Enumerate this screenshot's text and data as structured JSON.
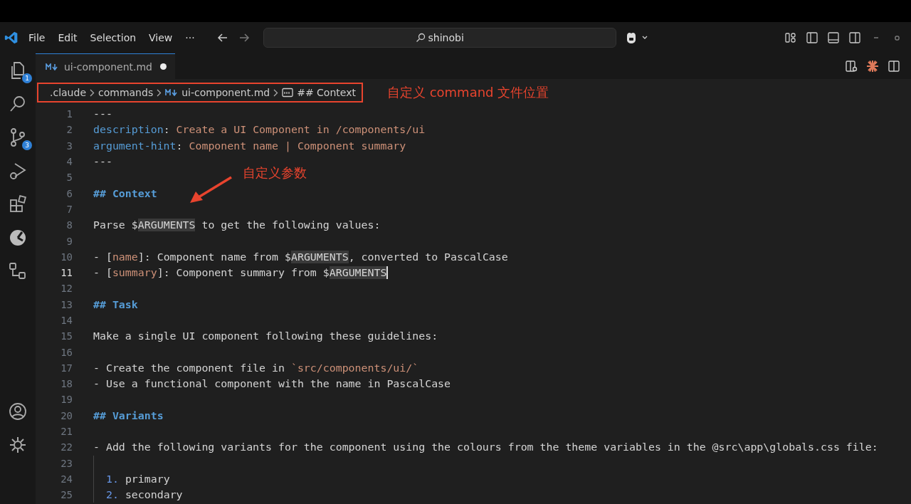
{
  "menu": [
    "File",
    "Edit",
    "Selection",
    "View",
    "···"
  ],
  "search": {
    "value": "shinobi"
  },
  "activity": [
    {
      "kind": "files",
      "badge": "1"
    },
    {
      "kind": "search"
    },
    {
      "kind": "scm",
      "badge": "3"
    },
    {
      "kind": "debug"
    },
    {
      "kind": "extensions"
    },
    {
      "kind": "remote"
    },
    {
      "kind": "flow"
    },
    {
      "kind": "account"
    },
    {
      "kind": "gear"
    }
  ],
  "tab": {
    "label": "ui-component.md",
    "modified": true
  },
  "breadcrumb": [
    {
      "kind": "folder",
      "label": ".claude"
    },
    {
      "kind": "folder",
      "label": "commands"
    },
    {
      "kind": "file",
      "label": "ui-component.md"
    },
    {
      "kind": "symbol",
      "label": "## Context"
    }
  ],
  "annotations": [
    {
      "kind": "box-label",
      "text": "自定义 command 文件位置"
    },
    {
      "kind": "arrow-label",
      "text": "自定义参数"
    }
  ],
  "lines": [
    {
      "n": "1",
      "tokens": [
        {
          "kind": "text",
          "t": "---"
        }
      ]
    },
    {
      "n": "2",
      "tokens": [
        {
          "kind": "key",
          "t": "description"
        },
        {
          "kind": "text",
          "t": ": "
        },
        {
          "kind": "value",
          "t": "Create a UI Component in /components/ui"
        }
      ]
    },
    {
      "n": "3",
      "tokens": [
        {
          "kind": "key",
          "t": "argument-hint"
        },
        {
          "kind": "text",
          "t": ": "
        },
        {
          "kind": "value",
          "t": "Component name | Component summary"
        }
      ]
    },
    {
      "n": "4",
      "tokens": [
        {
          "kind": "text",
          "t": "---"
        }
      ]
    },
    {
      "n": "5"
    },
    {
      "n": "6",
      "tokens": [
        {
          "kind": "heading",
          "t": "## Context"
        }
      ]
    },
    {
      "n": "7"
    },
    {
      "n": "8",
      "tokens": [
        {
          "kind": "text",
          "t": "Parse $"
        },
        {
          "kind": "var",
          "t": "ARGUMENTS"
        },
        {
          "kind": "text",
          "t": " to get the following values:"
        }
      ]
    },
    {
      "n": "9"
    },
    {
      "n": "10",
      "tokens": [
        {
          "kind": "text",
          "t": "- ["
        },
        {
          "kind": "link",
          "t": "name"
        },
        {
          "kind": "text",
          "t": "]: Component name from $"
        },
        {
          "kind": "var",
          "t": "ARGUMENTS"
        },
        {
          "kind": "text",
          "t": ", converted to PascalCase"
        }
      ]
    },
    {
      "n": "11",
      "current": true,
      "tokens": [
        {
          "kind": "text",
          "t": "- ["
        },
        {
          "kind": "link",
          "t": "summary"
        },
        {
          "kind": "text",
          "t": "]: Component summary from $"
        },
        {
          "kind": "var",
          "t": "ARGUMENTS"
        }
      ]
    },
    {
      "n": "12"
    },
    {
      "n": "13",
      "tokens": [
        {
          "kind": "heading",
          "t": "## Task"
        }
      ]
    },
    {
      "n": "14"
    },
    {
      "n": "15",
      "tokens": [
        {
          "kind": "text",
          "t": "Make a single UI component following these guidelines:"
        }
      ]
    },
    {
      "n": "16"
    },
    {
      "n": "17",
      "tokens": [
        {
          "kind": "text",
          "t": "- Create the component file in "
        },
        {
          "kind": "code",
          "t": "`src/components/ui/`"
        }
      ]
    },
    {
      "n": "18",
      "tokens": [
        {
          "kind": "text",
          "t": "- Use a functional component with the name in PascalCase"
        }
      ]
    },
    {
      "n": "19"
    },
    {
      "n": "20",
      "tokens": [
        {
          "kind": "heading",
          "t": "## Variants"
        }
      ]
    },
    {
      "n": "21"
    },
    {
      "n": "22",
      "tokens": [
        {
          "kind": "text",
          "t": "- Add the following variants for the component using the colours from the theme variables in the @src\\app\\globals.css file:"
        }
      ]
    },
    {
      "n": "23",
      "guide": true
    },
    {
      "n": "24",
      "guide": true,
      "tokens": [
        {
          "kind": "num",
          "t": "1."
        },
        {
          "kind": "text",
          "t": " primary"
        }
      ]
    },
    {
      "n": "25",
      "guide": true,
      "tokens": [
        {
          "kind": "num",
          "t": "2."
        },
        {
          "kind": "text",
          "t": " secondary"
        }
      ]
    }
  ]
}
